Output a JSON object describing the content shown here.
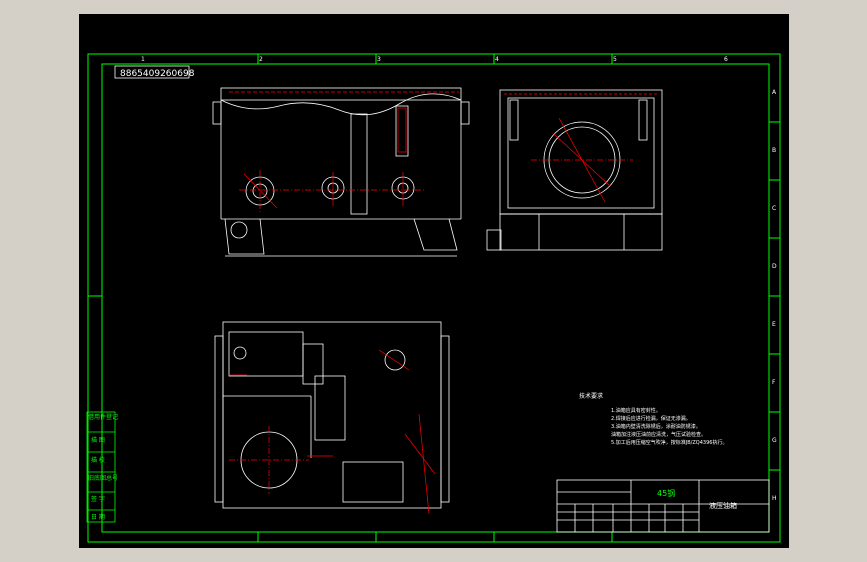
{
  "drawing": {
    "code": "8865409260698",
    "title_block": {
      "material": "45钢",
      "part_name": "液压油箱",
      "left_labels": [
        "借用件登记",
        "描 图",
        "描 校",
        "旧底图总号",
        "签 字",
        "日 期"
      ]
    },
    "tech_requirements": {
      "heading": "技术要求",
      "items": [
        "1.油箱应具有密封性。",
        "2.焊接后应进行检漏，保证无渗漏。",
        "3.油箱内壁清洗除锈后，涂耐油防锈漆。",
        "油箱加注液压油前应清洗，气压试验检查。",
        "5.加工后用压缩空气吹净，按标准JB/ZQ4396执行。"
      ]
    },
    "col_markers": [
      "1",
      "2",
      "3",
      "4",
      "5",
      "6"
    ],
    "row_markers": [
      "A",
      "B",
      "C",
      "D",
      "E",
      "F",
      "G",
      "H"
    ]
  },
  "colors": {
    "background": "#000000",
    "border": "#00ff00",
    "geometry": "#ffffff",
    "dimension": "#ff0000",
    "centerline": "#ff0000"
  }
}
